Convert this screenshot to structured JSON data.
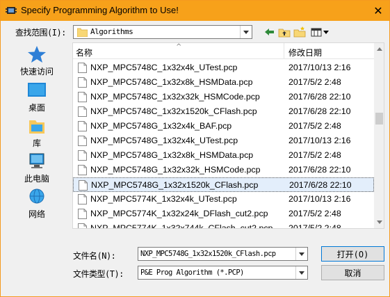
{
  "window": {
    "title": "Specify Programming Algorithm to Use!",
    "close_glyph": "✕"
  },
  "lookin": {
    "label": "查找范围(I):",
    "value": "Algorithms"
  },
  "places": [
    {
      "label": "快速访问",
      "icon": "star-icon"
    },
    {
      "label": "桌面",
      "icon": "desktop-icon"
    },
    {
      "label": "库",
      "icon": "library-icon"
    },
    {
      "label": "此电脑",
      "icon": "computer-icon"
    },
    {
      "label": "网络",
      "icon": "network-icon"
    }
  ],
  "columns": {
    "name": "名称",
    "date": "修改日期"
  },
  "files": [
    {
      "name": "NXP_MPC5748C_1x32x4k_UTest.pcp",
      "date": "2017/10/13 2:16"
    },
    {
      "name": "NXP_MPC5748C_1x32x8k_HSMData.pcp",
      "date": "2017/5/2 2:48"
    },
    {
      "name": "NXP_MPC5748C_1x32x32k_HSMCode.pcp",
      "date": "2017/6/28 22:10"
    },
    {
      "name": "NXP_MPC5748C_1x32x1520k_CFlash.pcp",
      "date": "2017/6/28 22:10"
    },
    {
      "name": "NXP_MPC5748G_1x32x4k_BAF.pcp",
      "date": "2017/5/2 2:48"
    },
    {
      "name": "NXP_MPC5748G_1x32x4k_UTest.pcp",
      "date": "2017/10/13 2:16"
    },
    {
      "name": "NXP_MPC5748G_1x32x8k_HSMData.pcp",
      "date": "2017/5/2 2:48"
    },
    {
      "name": "NXP_MPC5748G_1x32x32k_HSMCode.pcp",
      "date": "2017/6/28 22:10"
    },
    {
      "name": "NXP_MPC5748G_1x32x1520k_CFlash.pcp",
      "date": "2017/6/28 22:10",
      "selected": true
    },
    {
      "name": "NXP_MPC5774K_1x32x4k_UTest.pcp",
      "date": "2017/10/13 2:16"
    },
    {
      "name": "NXP_MPC5774K_1x32x24k_DFlash_cut2.pcp",
      "date": "2017/5/2 2:48"
    },
    {
      "name": "NXP_MPC5774K_1x32x744k_CFlash_cut2.pcp",
      "date": "2017/5/2 2:48"
    }
  ],
  "filename": {
    "label": "文件名(N):",
    "value": "NXP_MPC5748G_1x32x1520k_CFlash.pcp"
  },
  "filetype": {
    "label": "文件类型(T):",
    "value": "P&E Prog Algorithm (*.PCP)"
  },
  "buttons": {
    "open": "打开(O)",
    "cancel": "取消"
  },
  "colors": {
    "titlebar": "#f7a11a",
    "selection": "#e3eefb",
    "accent": "#0078d7"
  }
}
